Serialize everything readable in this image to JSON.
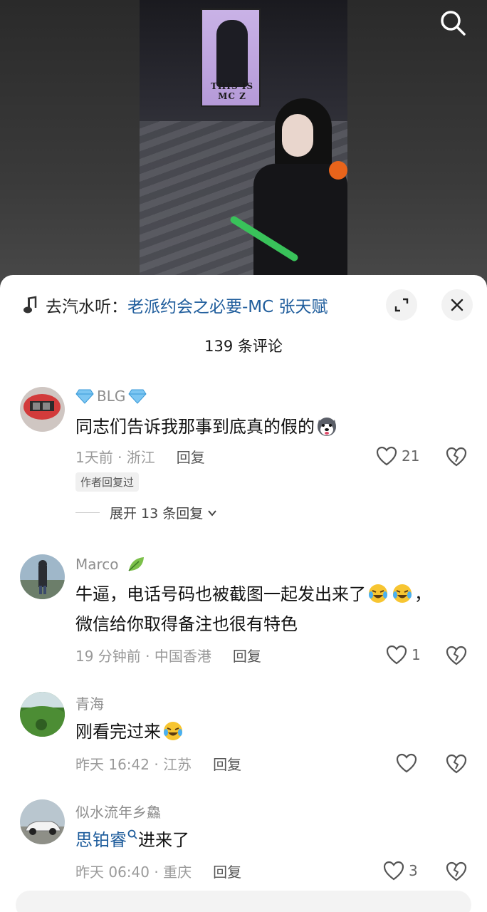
{
  "video": {
    "banner_text": "THIS IS MC Z"
  },
  "music": {
    "prefix": "去汽水听：",
    "song": "老派约会之必要-MC 张天赋"
  },
  "comments_header": {
    "count_label": "139 条评论"
  },
  "comments": [
    {
      "user": "BLG",
      "text": "同志们告诉我那事到底真的假的",
      "time_location": "1天前 · 浙江",
      "reply_label": "回复",
      "likes": "21",
      "author_tag": "作者回复过",
      "expand_label": "展开 13 条回复"
    },
    {
      "user": "Marco",
      "text_line1": "牛逼，电话号码也被截图一起发出来了",
      "text_line2": "微信给你取得备注也很有特色",
      "time_location": "19 分钟前 · 中国香港",
      "reply_label": "回复",
      "likes": "1"
    },
    {
      "user": "青海",
      "text": "刚看完过来",
      "time_location": "昨天 16:42 · 江苏",
      "reply_label": "回复",
      "likes": ""
    },
    {
      "user": "似水流年乡鱻",
      "mention": "思铂睿",
      "text": "进来了",
      "time_location": "昨天 06:40 · 重庆",
      "reply_label": "回复",
      "likes": "3"
    }
  ],
  "colors": {
    "link_blue": "#1f5d9c",
    "meta_gray": "#9a9a9a",
    "name_gray": "#8e8e8e",
    "sheet_bg": "#ffffff"
  }
}
